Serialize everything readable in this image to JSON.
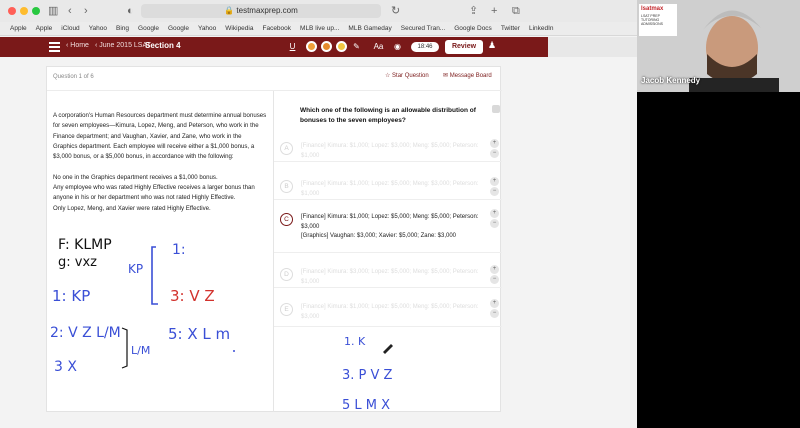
{
  "browser": {
    "url": "testmaxprep.com",
    "bookmarks": [
      "Apple",
      "Apple",
      "iCloud",
      "Yahoo",
      "Bing",
      "Google",
      "Google",
      "Yahoo",
      "Wikipedia",
      "Facebook",
      "MLB live up...",
      "MLB Gameday",
      "Secured Tran...",
      "Google Docs",
      "Twitter",
      "LinkedIn"
    ]
  },
  "app": {
    "home": "‹ Home",
    "test": "‹ June 2015 LSAT",
    "section": "Section 4",
    "timer": "18:46",
    "review": "Review"
  },
  "question": {
    "number": "Question 1 of 6",
    "star": "Star Question",
    "message": "Message Board",
    "passage": [
      "A corporation's Human Resources department must determine annual bonuses for seven employees—Kimura, Lopez, Meng, and Peterson, who work in the Finance department; and Vaughan, Xavier, and Zane, who work in the Graphics department. Each employee will receive either a $1,000 bonus, a $3,000 bonus, or a $5,000 bonus, in accordance with the following:",
      "No one in the Graphics department receives a $1,000 bonus.\nAny employee who was rated Highly Effective receives a larger bonus than anyone in his or her department who was not rated Highly Effective.\nOnly Lopez, Meng, and Xavier were rated Highly Effective."
    ],
    "stem": "Which one of the following is an allowable distribution of bonuses to the seven employees?",
    "options": [
      {
        "letter": "A",
        "text": "[Finance] Kimura: $1,000; Lopez: $3,000; Meng: $5,000; Peterson: $1,000"
      },
      {
        "letter": "B",
        "text": "[Finance] Kimura: $1,000; Lopez: $5,000; Meng: $3,000; Peterson: $1,000"
      },
      {
        "letter": "C",
        "text": "[Finance] Kimura: $1,000; Lopez: $5,000; Meng: $5,000; Peterson: $3,000\n[Graphics] Vaughan: $3,000; Xavier: $5,000; Zane: $3,000"
      },
      {
        "letter": "D",
        "text": "[Finance] Kimura: $3,000; Lopez: $5,000; Meng: $5,000; Peterson: $1,000"
      },
      {
        "letter": "E",
        "text": "[Finance] Kimura: $1,000; Lopez: $5,000; Meng: $5,000; Peterson: $3,000"
      }
    ]
  },
  "webcam": {
    "name": "Jacob Kennedy",
    "logo_title": "lsatmax",
    "logo_sub": "LSAT PREP\nTUTORING\nADMISSIONS"
  },
  "handwriting": {
    "f_line": "F: KLMP",
    "g_line": "g: vxz",
    "kp_label": "KP",
    "one_kp": "1: KP",
    "one_colon": "1:",
    "three_vz": "3: V Z",
    "two_line": "2: V Z L/M",
    "lm": "L/M",
    "five_line": "5: X L m",
    "three_x": "3 X",
    "r_one_k": "1. K",
    "r_three": "3. P V Z",
    "r_five": "5 L M X"
  }
}
